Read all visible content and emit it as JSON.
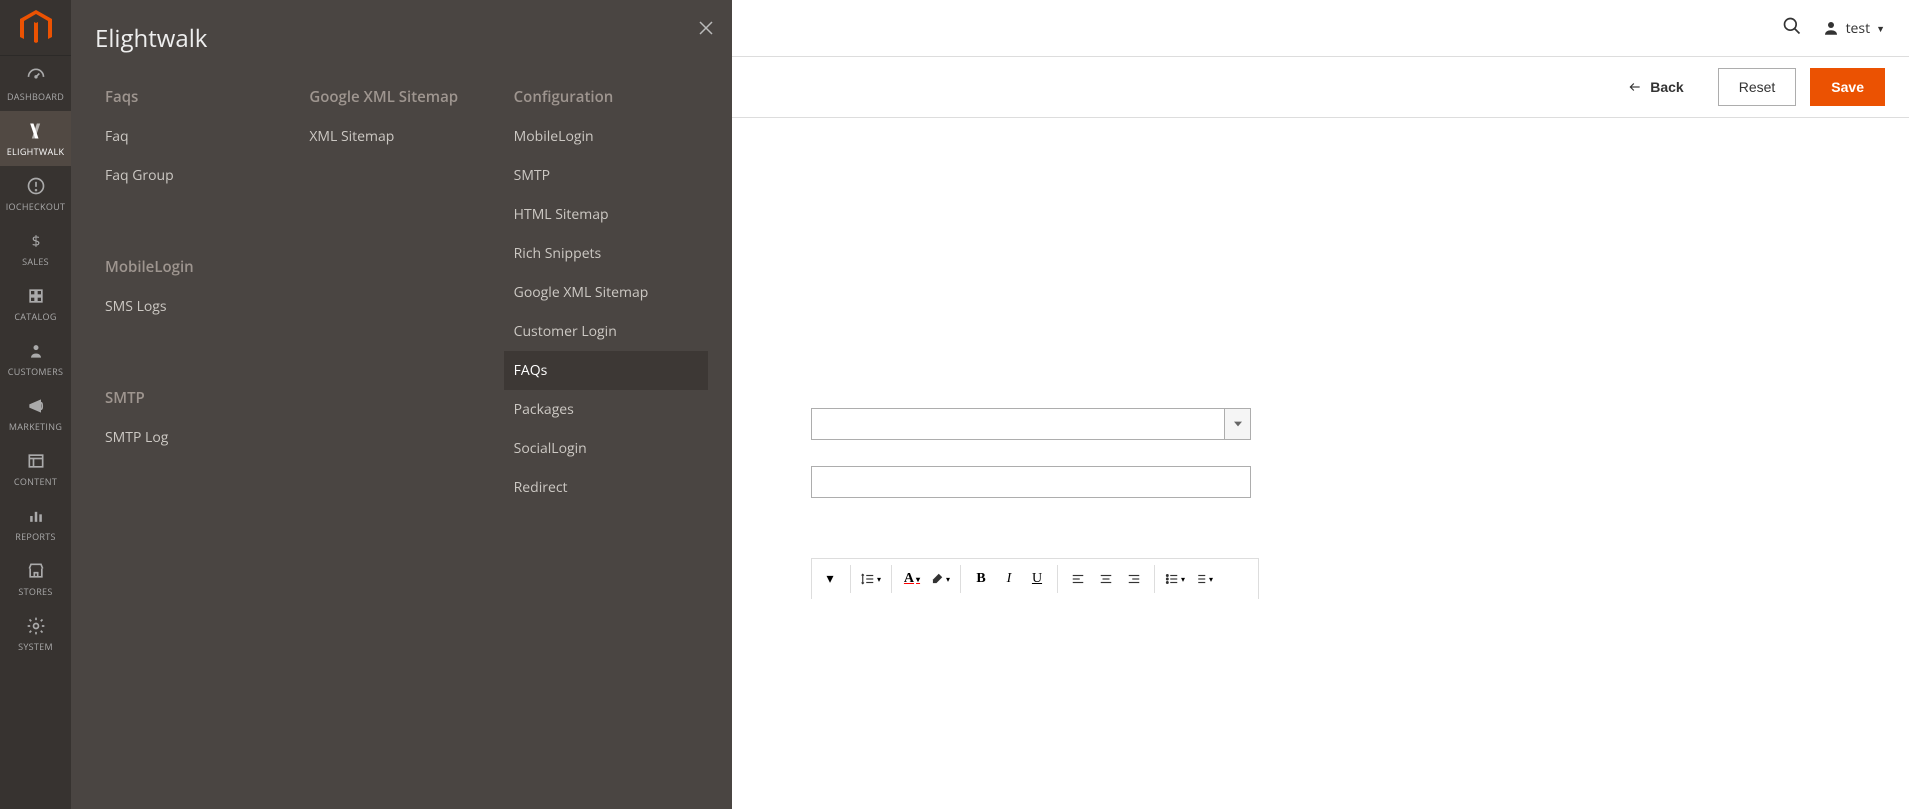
{
  "left_nav": {
    "items": [
      {
        "label": "DASHBOARD"
      },
      {
        "label": "ELIGHTWALK"
      },
      {
        "label": "IOCHECKOUT"
      },
      {
        "label": "SALES"
      },
      {
        "label": "CATALOG"
      },
      {
        "label": "CUSTOMERS"
      },
      {
        "label": "MARKETING"
      },
      {
        "label": "CONTENT"
      },
      {
        "label": "REPORTS"
      },
      {
        "label": "STORES"
      },
      {
        "label": "SYSTEM"
      }
    ]
  },
  "flyout": {
    "title": "Elightwalk",
    "col1": {
      "sections": [
        {
          "heading": "Faqs",
          "items": [
            {
              "label": "Faq"
            },
            {
              "label": "Faq Group"
            }
          ]
        },
        {
          "heading": "MobileLogin",
          "items": [
            {
              "label": "SMS Logs"
            }
          ]
        },
        {
          "heading": "SMTP",
          "items": [
            {
              "label": "SMTP Log"
            }
          ]
        }
      ]
    },
    "col2": {
      "sections": [
        {
          "heading": "Google XML Sitemap",
          "items": [
            {
              "label": "XML Sitemap"
            }
          ]
        }
      ]
    },
    "col3": {
      "sections": [
        {
          "heading": "Configuration",
          "items": [
            {
              "label": "MobileLogin"
            },
            {
              "label": "SMTP"
            },
            {
              "label": "HTML Sitemap"
            },
            {
              "label": "Rich Snippets"
            },
            {
              "label": "Google XML Sitemap"
            },
            {
              "label": "Customer Login"
            },
            {
              "label": "FAQs"
            },
            {
              "label": "Packages"
            },
            {
              "label": "SocialLogin"
            },
            {
              "label": "Redirect"
            }
          ]
        }
      ]
    }
  },
  "header": {
    "user_label": "test"
  },
  "actions": {
    "back": "Back",
    "reset": "Reset",
    "save": "Save"
  },
  "editor": {
    "bold": "B",
    "italic": "I",
    "underline": "U"
  }
}
